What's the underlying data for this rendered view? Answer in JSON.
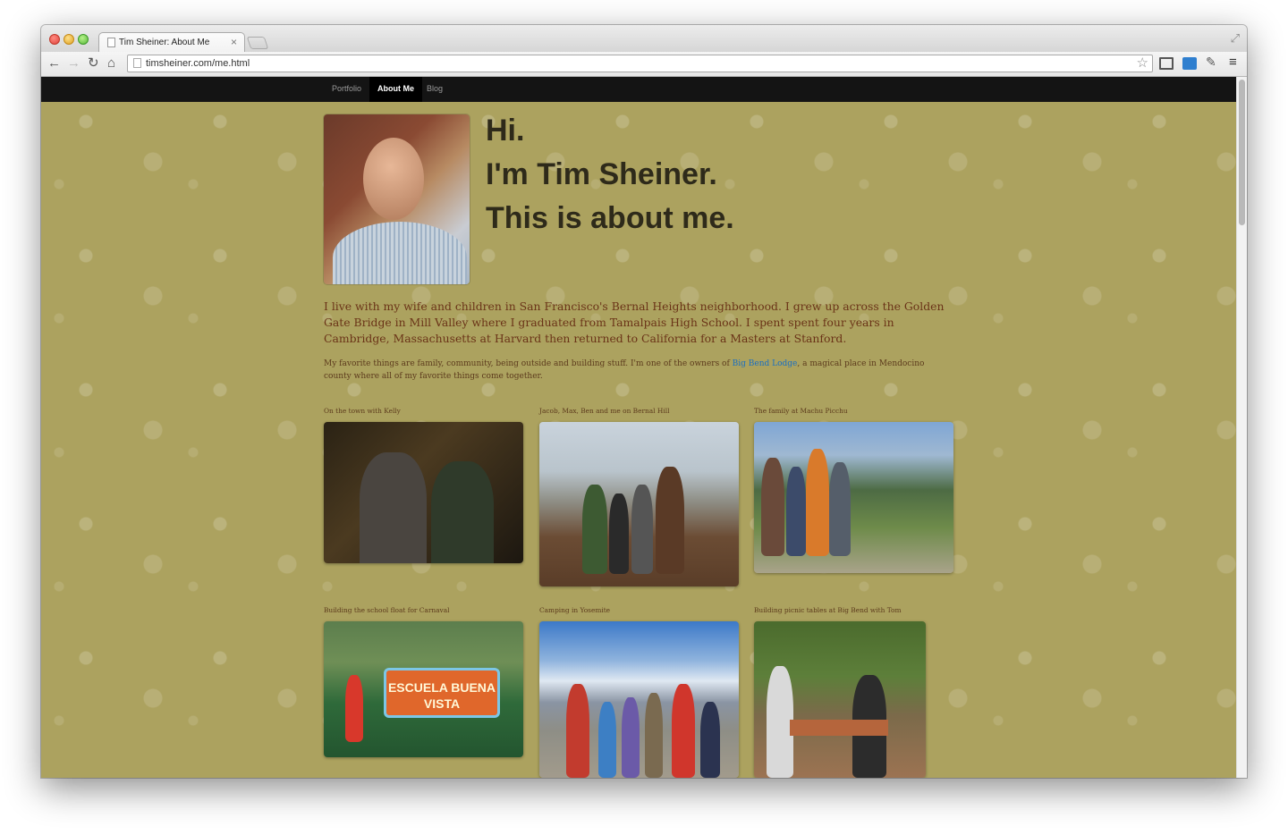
{
  "browser": {
    "tab_title": "Tim Sheiner: About Me",
    "tab_close": "×",
    "url": "timsheiner.com/me.html"
  },
  "site_nav": {
    "items": [
      {
        "label": "Portfolio"
      },
      {
        "label": "About Me",
        "active": true
      },
      {
        "label": "Blog"
      }
    ]
  },
  "hero": {
    "line1": "Hi.",
    "line2": "I'm Tim Sheiner.",
    "line3": "This is about me."
  },
  "intro": {
    "paragraph": "I live with my wife and children in San Francisco's Bernal Heights neighborhood. I grew up across the Golden Gate Bridge in Mill Valley where I graduated from Tamalpais High School. I spent spent four years in Cambridge, Massachusetts at Harvard then returned to California for a Masters at Stanford.",
    "sub_before": "My favorite things are family, community, being outside and building stuff. I'm one of the owners of ",
    "sub_link": "Big Bend Lodge",
    "sub_after": ", a magical place in Mendocino county where all of my favorite things come together."
  },
  "gallery": [
    {
      "caption": "On the town with Kelly"
    },
    {
      "caption": "Jacob, Max, Ben and me on Bernal Hill"
    },
    {
      "caption": "The family at Machu Picchu"
    },
    {
      "caption": "Building the school float for Carnaval",
      "sign_text": "ESCUELA BUENA VISTA"
    },
    {
      "caption": "Camping in Yosemite"
    },
    {
      "caption": "Building picnic tables at Big Bend with Tom"
    }
  ],
  "colors": {
    "page_background": "#aca25f",
    "nav_background": "#141414",
    "heading": "#2e2a1a",
    "body_text": "#6a3317",
    "link": "#1a6ec1"
  },
  "icons": [
    "back-icon",
    "forward-icon",
    "reload-icon",
    "home-icon",
    "star-icon",
    "menu-icon"
  ]
}
